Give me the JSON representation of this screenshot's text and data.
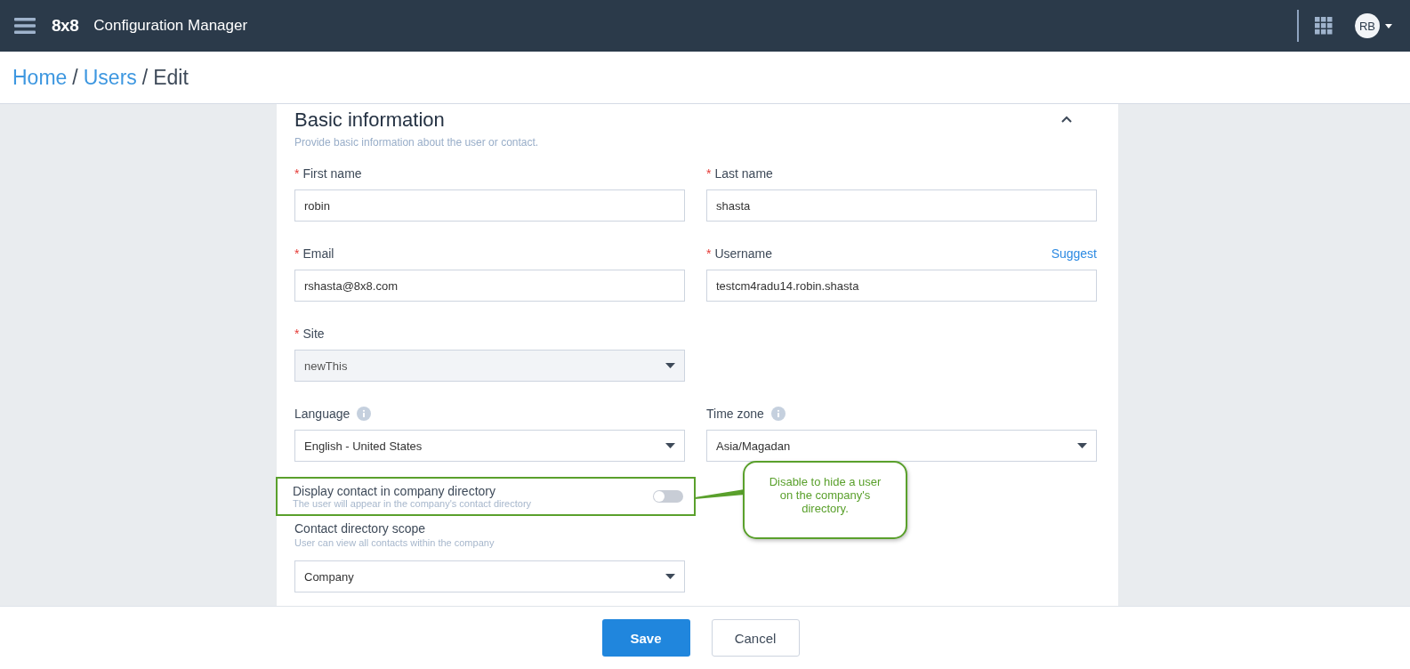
{
  "header": {
    "logo": "8x8",
    "title": "Configuration Manager",
    "avatar": "RB"
  },
  "breadcrumb": {
    "items": [
      {
        "label": "Home",
        "kind": "link"
      },
      {
        "label": "Users",
        "kind": "link"
      },
      {
        "label": "Edit",
        "kind": "current"
      }
    ],
    "separators": [
      "/",
      "/"
    ]
  },
  "form": {
    "title": "Basic information",
    "subtitle": "Provide basic information about the user or contact.",
    "expanded": true,
    "rows": [
      [
        {
          "kind": "text",
          "marker": "*",
          "label": "First name",
          "value": "robin"
        },
        {
          "kind": "text",
          "marker": "*",
          "label": "Last name",
          "value": "shasta"
        }
      ],
      [
        {
          "kind": "text",
          "marker": "*",
          "label": "Email",
          "value": "rshasta@8x8.com"
        },
        {
          "kind": "text",
          "marker": "*",
          "label": "Username",
          "action": "Suggest",
          "value": "testcm4radu14.robin.shasta"
        }
      ],
      [
        {
          "kind": "select",
          "marker": "*",
          "label": "Site",
          "value": "newThis",
          "disabled": true
        }
      ],
      [
        {
          "kind": "select",
          "label": "Language",
          "info": true,
          "value": "English - United States",
          "disabled": false
        },
        {
          "kind": "select",
          "label": "Time zone",
          "info": true,
          "value": "Asia/Magadan",
          "disabled": false
        }
      ],
      [
        {
          "kind": "toggle",
          "label": "Display contact in company directory",
          "hint": "The user will appear in the company's contact directory",
          "on": false,
          "highlighted": true,
          "callout": "Disable to hide a user on the company's directory."
        }
      ],
      [
        {
          "kind": "select",
          "label": "Contact directory scope",
          "hint": "User can view all contacts within the company",
          "value": "Company",
          "disabled": false
        }
      ]
    ]
  },
  "footer": {
    "buttons": [
      {
        "label": "Save",
        "kind": "primary"
      },
      {
        "label": "Cancel",
        "kind": "secondary"
      }
    ]
  }
}
